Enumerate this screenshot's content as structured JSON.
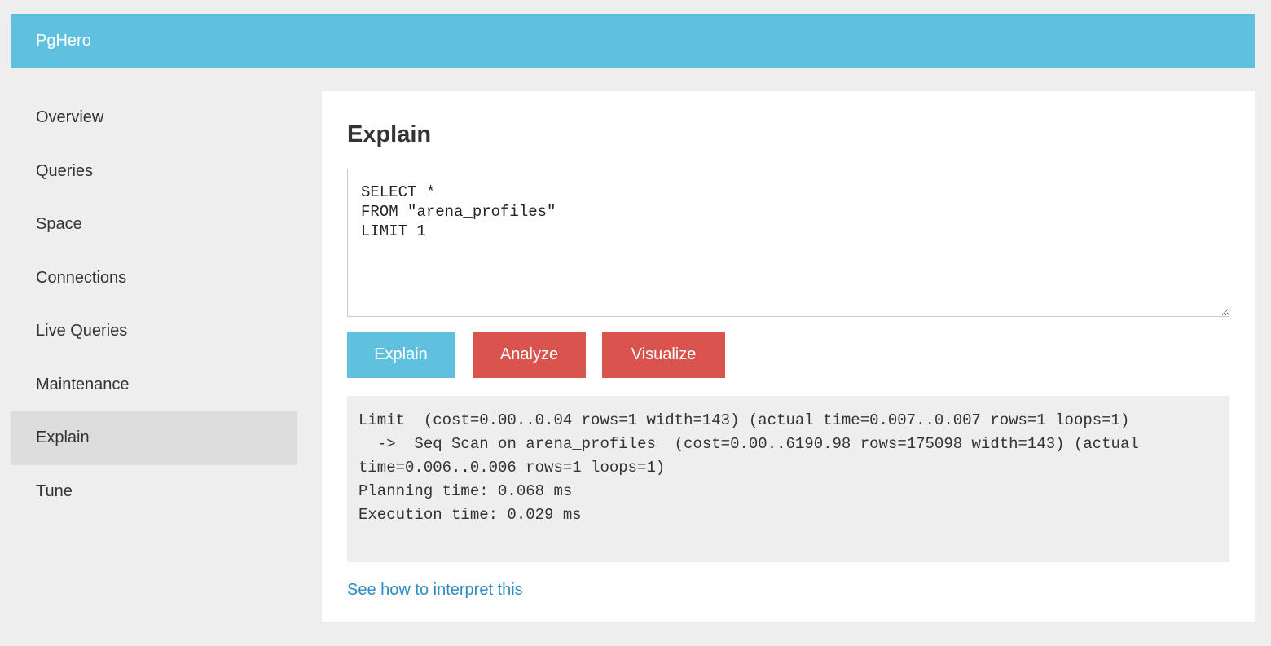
{
  "header": {
    "brand": "PgHero"
  },
  "sidebar": {
    "items": [
      {
        "label": "Overview"
      },
      {
        "label": "Queries"
      },
      {
        "label": "Space"
      },
      {
        "label": "Connections"
      },
      {
        "label": "Live Queries"
      },
      {
        "label": "Maintenance"
      },
      {
        "label": "Explain",
        "active": true
      },
      {
        "label": "Tune"
      }
    ]
  },
  "main": {
    "title": "Explain",
    "query": "SELECT *\nFROM \"arena_profiles\"\nLIMIT 1",
    "buttons": {
      "explain": "Explain",
      "analyze": "Analyze",
      "visualize": "Visualize"
    },
    "output": "Limit  (cost=0.00..0.04 rows=1 width=143) (actual time=0.007..0.007 rows=1 loops=1)\n  ->  Seq Scan on arena_profiles  (cost=0.00..6190.98 rows=175098 width=143) (actual time=0.006..0.006 rows=1 loops=1)\nPlanning time: 0.068 ms\nExecution time: 0.029 ms",
    "help_link": "See how to interpret this"
  },
  "colors": {
    "header_bg": "#5fc1de",
    "primary_button": "#5fc1de",
    "danger_button": "#d9534f",
    "link": "#2b8cc4",
    "active_nav_bg": "#dddddd",
    "page_bg": "#eeeeee"
  }
}
